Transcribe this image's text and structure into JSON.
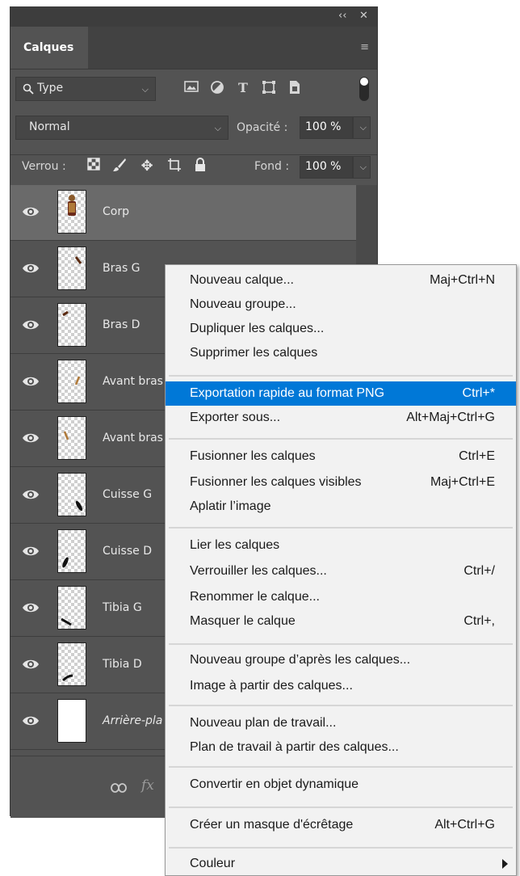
{
  "panel": {
    "controls": {
      "collapse": "‹‹",
      "close": "✕"
    },
    "tab": "Calques",
    "filter": {
      "kind": "Type",
      "icons": [
        "image-filter-icon",
        "adjustment-filter-icon",
        "text-filter-icon",
        "shape-filter-icon",
        "smart-object-filter-icon"
      ]
    },
    "blend_mode": "Normal",
    "opacity_label": "Opacité :",
    "opacity_value": "100 %",
    "lock_label": "Verrou :",
    "fill_label": "Fond :",
    "fill_value": "100 %",
    "layers": [
      {
        "name": "Corp",
        "selected": true
      },
      {
        "name": "Bras G"
      },
      {
        "name": "Bras D"
      },
      {
        "name": "Avant bras"
      },
      {
        "name": "Avant bras"
      },
      {
        "name": "Cuisse G"
      },
      {
        "name": "Cuisse D"
      },
      {
        "name": "Tibia G"
      },
      {
        "name": "Tibia D"
      },
      {
        "name": "Arrière-pla",
        "italic": true
      }
    ],
    "bottom_fx": "fx"
  },
  "context_menu": {
    "items": [
      {
        "label": "Nouveau calque...",
        "shortcut": "Maj+Ctrl+N"
      },
      {
        "label": "Nouveau groupe...",
        "shortcut": ""
      },
      {
        "label": "Dupliquer les calques...",
        "shortcut": ""
      },
      {
        "label": "Supprimer les calques",
        "shortcut": ""
      },
      {
        "label": "Exportation rapide au format PNG",
        "shortcut": "Ctrl+*",
        "highlighted": true
      },
      {
        "label": "Exporter sous...",
        "shortcut": "Alt+Maj+Ctrl+G"
      },
      {
        "label": "Fusionner les calques",
        "shortcut": "Ctrl+E"
      },
      {
        "label": "Fusionner les calques visibles",
        "shortcut": "Maj+Ctrl+E"
      },
      {
        "label": "Aplatir l’image",
        "shortcut": ""
      },
      {
        "label": "Lier les calques",
        "shortcut": ""
      },
      {
        "label": "Verrouiller les calques...",
        "shortcut": "Ctrl+/"
      },
      {
        "label": "Renommer le calque...",
        "shortcut": ""
      },
      {
        "label": "Masquer le calque",
        "shortcut": "Ctrl+,"
      },
      {
        "label": "Nouveau groupe d’après les calques...",
        "shortcut": ""
      },
      {
        "label": "Image à partir des calques...",
        "shortcut": ""
      },
      {
        "label": "Nouveau plan de travail...",
        "shortcut": ""
      },
      {
        "label": "Plan de travail à partir des calques...",
        "shortcut": ""
      },
      {
        "label": "Convertir en objet dynamique",
        "shortcut": ""
      },
      {
        "label": "Créer un masque d'écrêtage",
        "shortcut": "Alt+Ctrl+G"
      },
      {
        "label": "Couleur",
        "shortcut": "",
        "submenu": true
      }
    ]
  },
  "colors": {
    "panel_bg": "#535353",
    "menu_bg": "#f2f2f2",
    "highlight": "#0078d7"
  }
}
